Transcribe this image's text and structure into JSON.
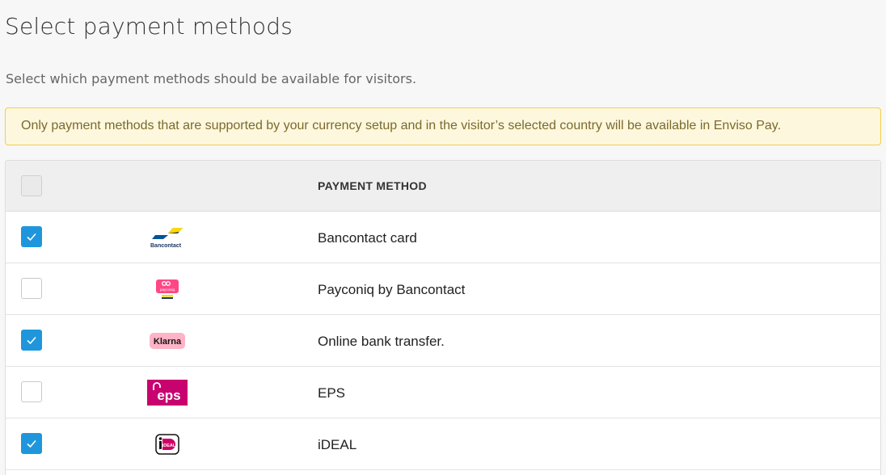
{
  "page": {
    "title": "Select payment methods",
    "subtitle": "Select which payment methods should be available for visitors.",
    "notice": "Only payment methods that are supported by your currency setup and in the visitor’s selected country will be available in Enviso Pay."
  },
  "table": {
    "header": {
      "select_all_checked": false,
      "column_label": "PAYMENT METHOD"
    },
    "rows": [
      {
        "name": "Bancontact card",
        "checked": true,
        "logo": "bancontact-logo",
        "logo_text": "Bancontact"
      },
      {
        "name": "Payconiq by Bancontact",
        "checked": false,
        "logo": "payconiq-logo",
        "logo_text": "payconiq"
      },
      {
        "name": "Online bank transfer.",
        "checked": true,
        "logo": "klarna-logo",
        "logo_text": "Klarna"
      },
      {
        "name": "EPS",
        "checked": false,
        "logo": "eps-logo",
        "logo_text": "eps"
      },
      {
        "name": "iDEAL",
        "checked": true,
        "logo": "ideal-logo",
        "logo_text": "iDEAL"
      }
    ]
  },
  "colors": {
    "accent": "#1f96dc",
    "notice_bg": "#fdf7dd",
    "notice_border": "#f0cf4e",
    "klarna_pink": "#ffb3c7",
    "eps_magenta": "#c8036f",
    "ideal_pink": "#cc0066"
  }
}
